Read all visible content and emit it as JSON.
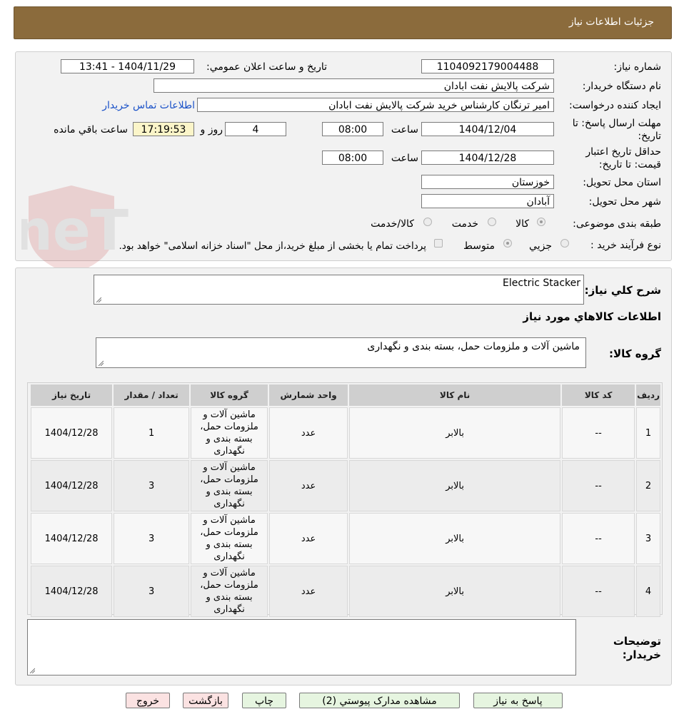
{
  "header": {
    "title": "جزئیات اطلاعات نیاز"
  },
  "form": {
    "need_number_label": "شماره نیاز:",
    "need_number": "1104092179004488",
    "announce_label": "تاریخ و ساعت اعلان عمومي:",
    "announce_value": "1404/11/29 - 13:41",
    "buyer_org_label": "نام دستگاه خریدار:",
    "buyer_org": "شرکت پالایش نفت ابادان",
    "requester_label": "ایجاد کننده درخواست:",
    "requester": "امیر ترنگان کارشناس خرید شرکت پالایش نفت ابادان",
    "contact_link": "اطلاعات تماس خریدار",
    "deadline_label_1": "مهلت ارسال پاسخ: تا",
    "deadline_label_2": "تاریخ:",
    "deadline_date": "1404/12/04",
    "time_label": "ساعت",
    "deadline_time": "08:00",
    "days_value": "4",
    "days_label": "روز و",
    "remaining_time": "17:19:53",
    "remaining_label": "ساعت باقي مانده",
    "validity_label_1": "حداقل تاریخ اعتبار",
    "validity_label_2": "قیمت: تا تاریخ:",
    "validity_date": "1404/12/28",
    "validity_time": "08:00",
    "province_label": "استان محل تحویل:",
    "province": "خوزستان",
    "city_label": "شهر محل تحویل:",
    "city": "آبادان",
    "category_label": "طبقه بندی موضوعی:",
    "category_options": [
      "کالا",
      "خدمت",
      "کالا/خدمت"
    ],
    "process_label": "نوع فرآیند خرید :",
    "process_options": [
      "جزیي",
      "متوسط"
    ],
    "payment_note": "پرداخت تمام یا بخشی از مبلغ خرید،از محل \"اسناد خزانه اسلامی\" خواهد بود."
  },
  "description": {
    "label": "شرح کلي نیاز:",
    "value": "Electric Stacker"
  },
  "goods": {
    "section_title": "اطلاعات کالاهاي مورد نیاز",
    "group_label": "گروه کالا:",
    "group_value": "ماشین آلات و ملزومات حمل، بسته بندی و نگهداری",
    "columns": [
      "ردیف",
      "کد کالا",
      "نام کالا",
      "واحد شمارش",
      "گروه کالا",
      "تعداد / مقدار",
      "تاریخ نیاز"
    ],
    "rows": [
      {
        "row": "1",
        "code": "--",
        "name": "بالابر",
        "unit": "عدد",
        "group": "ماشین آلات و ملزومات حمل، بسته بندی و نگهداری",
        "qty": "1",
        "date": "1404/12/28"
      },
      {
        "row": "2",
        "code": "--",
        "name": "بالابر",
        "unit": "عدد",
        "group": "ماشین آلات و ملزومات حمل، بسته بندی و نگهداری",
        "qty": "3",
        "date": "1404/12/28"
      },
      {
        "row": "3",
        "code": "--",
        "name": "بالابر",
        "unit": "عدد",
        "group": "ماشین آلات و ملزومات حمل، بسته بندی و نگهداری",
        "qty": "3",
        "date": "1404/12/28"
      },
      {
        "row": "4",
        "code": "--",
        "name": "بالابر",
        "unit": "عدد",
        "group": "ماشین آلات و ملزومات حمل، بسته بندی و نگهداری",
        "qty": "3",
        "date": "1404/12/28"
      }
    ]
  },
  "buyer_notes": {
    "label_1": "توضیحات",
    "label_2": "خریدار:",
    "value": ""
  },
  "buttons": {
    "reply": "پاسخ به نیاز",
    "attachments": "مشاهده مدارک پیوستي (2)",
    "print": "چاپ",
    "back": "بازگشت",
    "exit": "خروج"
  },
  "colors": {
    "header_bg": "#8b6b3c",
    "link": "#1b52c8",
    "timer_bg": "#fbf5c9",
    "btn_green": "#e6f5e0",
    "btn_pink": "#fbe2e2"
  }
}
